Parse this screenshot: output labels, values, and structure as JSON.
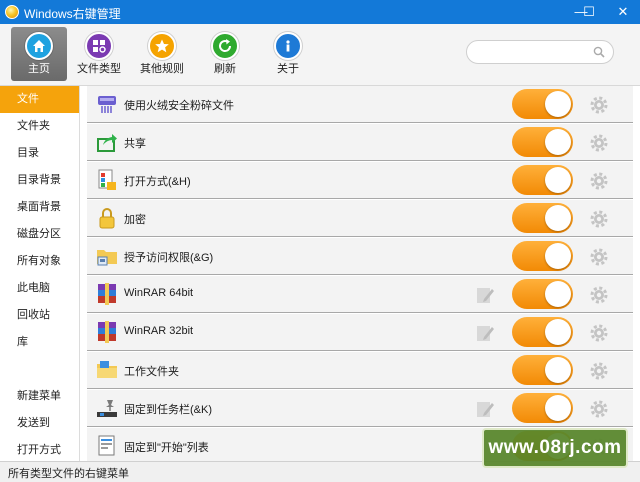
{
  "window": {
    "title": "Windows右键管理",
    "min_glyph": "—",
    "max_glyph": "☐",
    "close_glyph": "✕"
  },
  "toolbar": {
    "buttons": [
      {
        "label": "主页",
        "icon": "home-icon",
        "color": "#1fa2e0",
        "active": true
      },
      {
        "label": "文件类型",
        "icon": "file-types-icon",
        "color": "#7b3ab2"
      },
      {
        "label": "其他规则",
        "icon": "star-icon",
        "color": "#f5a300"
      },
      {
        "label": "刷新",
        "icon": "refresh-icon",
        "color": "#2faa2f"
      },
      {
        "label": "关于",
        "icon": "info-icon",
        "color": "#1e7ad6"
      }
    ],
    "search_placeholder": ""
  },
  "sidebar": {
    "items": [
      {
        "label": "文件",
        "active": true
      },
      {
        "label": "文件夹"
      },
      {
        "label": "目录"
      },
      {
        "label": "目录背景"
      },
      {
        "label": "桌面背景"
      },
      {
        "label": "磁盘分区"
      },
      {
        "label": "所有对象"
      },
      {
        "label": "此电脑"
      },
      {
        "label": "回收站"
      },
      {
        "label": "库"
      },
      {
        "label": "新建菜单"
      },
      {
        "label": "发送到"
      },
      {
        "label": "打开方式"
      }
    ]
  },
  "menu_items": [
    {
      "label": "使用火绒安全粉碎文件",
      "icon": "shredder-icon",
      "enabled": true,
      "has_edit": false
    },
    {
      "label": "共享",
      "icon": "share-icon",
      "enabled": true,
      "has_edit": false
    },
    {
      "label": "打开方式(&H)",
      "icon": "open-with-icon",
      "enabled": true,
      "has_edit": false
    },
    {
      "label": "加密",
      "icon": "lock-icon",
      "enabled": true,
      "has_edit": false
    },
    {
      "label": "授予访问权限(&G)",
      "icon": "folder-share-icon",
      "enabled": true,
      "has_edit": false
    },
    {
      "label": "WinRAR 64bit",
      "icon": "winrar-icon",
      "enabled": true,
      "has_edit": true
    },
    {
      "label": "WinRAR 32bit",
      "icon": "winrar-icon",
      "enabled": true,
      "has_edit": true
    },
    {
      "label": "工作文件夹",
      "icon": "work-folder-icon",
      "enabled": true,
      "has_edit": false
    },
    {
      "label": "固定到任务栏(&K)",
      "icon": "pin-taskbar-icon",
      "enabled": true,
      "has_edit": true
    },
    {
      "label": "固定到\"开始\"列表",
      "icon": "pin-start-icon",
      "enabled": true,
      "has_edit": false
    }
  ],
  "status": {
    "text": "所有类型文件的右键菜单"
  },
  "watermark": {
    "text": "www.08rj.com"
  },
  "colors": {
    "accent": "#f5a30c",
    "titlebar": "#1379d8"
  }
}
